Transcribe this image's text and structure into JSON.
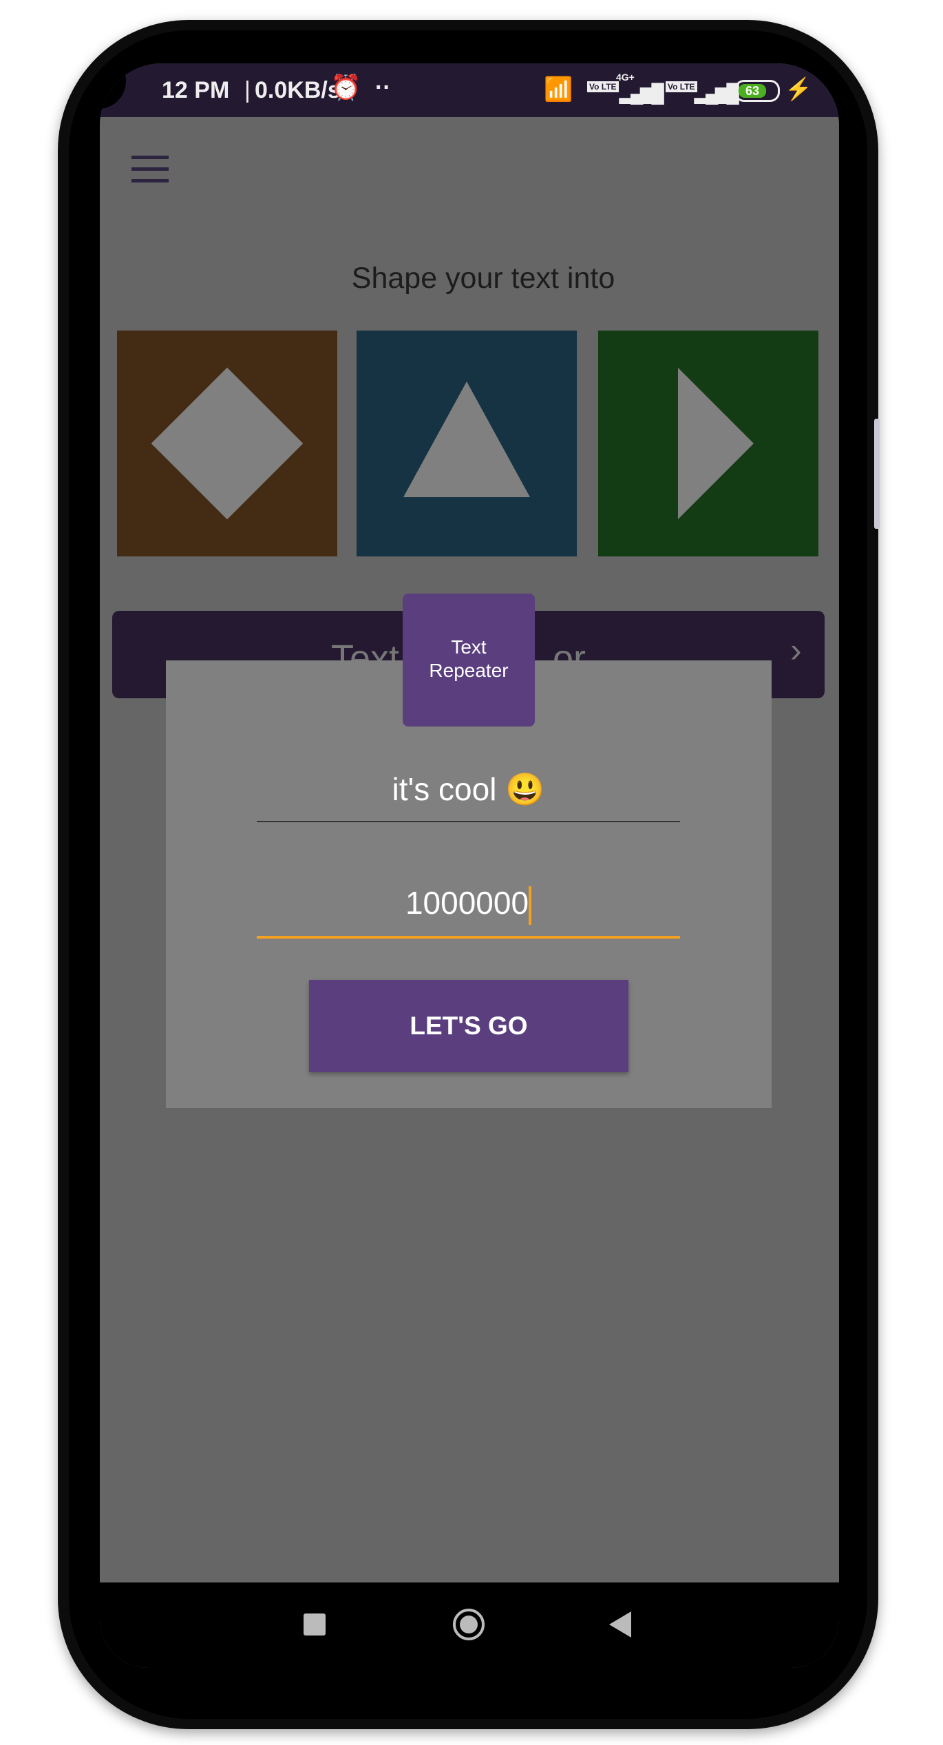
{
  "status_bar": {
    "time": "12 PM",
    "speed": "0.0KB/s",
    "network": "4G+",
    "volte": "Vo LTE",
    "battery": "63"
  },
  "header": {
    "menu_icon": "hamburger-icon"
  },
  "main": {
    "heading": "Shape your text into",
    "shapes": [
      {
        "name": "diamond",
        "color": "#432b14"
      },
      {
        "name": "triangle",
        "color": "#153343"
      },
      {
        "name": "arrow",
        "color": "#143c14"
      }
    ],
    "bar_label_left": "Text",
    "bar_label_right": "or"
  },
  "dialog": {
    "tag_label_1": "Text",
    "tag_label_2": "Repeater",
    "text_value": "it's cool 😃",
    "count_value": "1000000",
    "button_label": "LET'S GO",
    "accent": "#f4a020",
    "purple": "#5a3e7e"
  },
  "nav": {
    "icons": [
      "recent-apps-icon",
      "home-icon",
      "back-icon"
    ]
  }
}
